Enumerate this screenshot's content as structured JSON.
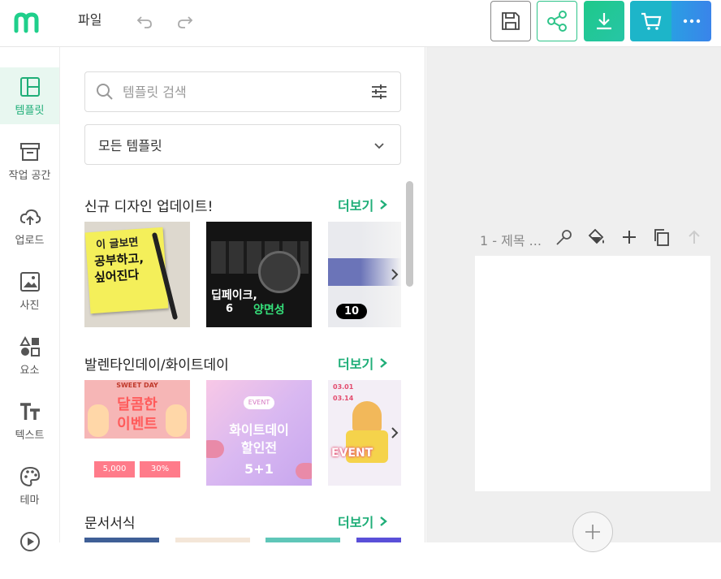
{
  "topbar": {
    "file_label": "파일",
    "icons": [
      "logo-icon",
      "undo-icon",
      "redo-icon",
      "save-icon",
      "share-icon",
      "download-icon",
      "cart-icon",
      "more-icon"
    ],
    "colors": {
      "brand": "#1fcf8b",
      "download": "#1ec98a",
      "cart": "#1db5c9",
      "more": "#3a84ea"
    }
  },
  "sidebar": {
    "items": [
      {
        "label": "템플릿",
        "icon": "template-icon",
        "active": true
      },
      {
        "label": "작업 공간",
        "icon": "archive-icon"
      },
      {
        "label": "업로드",
        "icon": "upload-cloud-icon"
      },
      {
        "label": "사진",
        "icon": "image-icon"
      },
      {
        "label": "요소",
        "icon": "shapes-icon"
      },
      {
        "label": "텍스트",
        "icon": "text-icon"
      },
      {
        "label": "테마",
        "icon": "palette-icon"
      }
    ]
  },
  "panel": {
    "search_placeholder": "템플릿 검색",
    "select_value": "모든 템플릿",
    "sections": [
      {
        "title": "신규 디자인 업데이트!",
        "more": "더보기",
        "thumbs": [
          {
            "kind": "study",
            "text1": "이 글보면",
            "text2": "공부하고,",
            "text3": "싶어진다"
          },
          {
            "kind": "deepfake",
            "text1": "딥페이크,",
            "num": "6",
            "text2": "양면성"
          },
          {
            "kind": "biz",
            "badge": "10"
          }
        ]
      },
      {
        "title": "발렌타인데이/화이트데이",
        "more": "더보기",
        "thumbs": [
          {
            "kind": "sweet",
            "text1": "SWEET DAY",
            "text2": "달콤한",
            "text3": "이벤트",
            "price1": "5,000",
            "price2": "30%"
          },
          {
            "kind": "white",
            "text1": "EVENT",
            "text2": "화이트데이",
            "text3": "할인전",
            "text4": "5+1"
          },
          {
            "kind": "event",
            "text1": "03.01",
            "text2": "03.14",
            "text3": "EVENT"
          }
        ]
      },
      {
        "title": "문서서식",
        "more": "더보기"
      }
    ]
  },
  "canvas": {
    "page_label": "1 - 제목 ...",
    "tools": [
      "magic-wand-icon",
      "paint-bucket-icon",
      "plus-icon",
      "copy-icon",
      "arrow-up-icon"
    ]
  }
}
